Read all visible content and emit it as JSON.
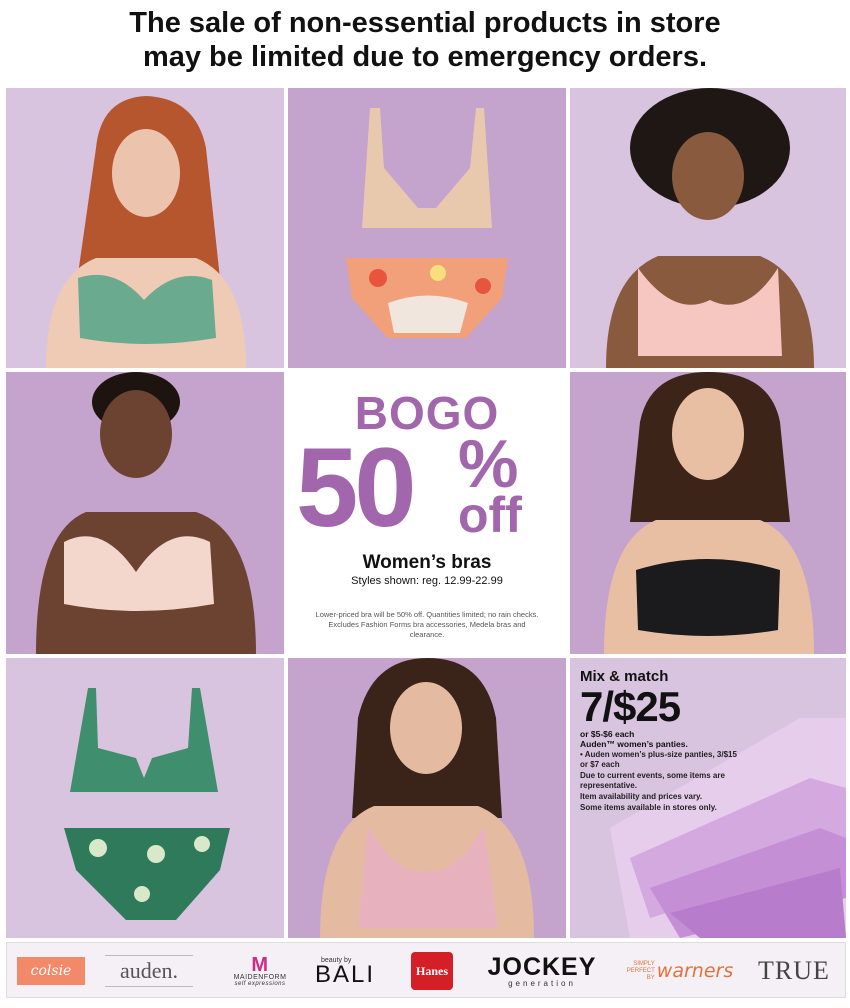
{
  "header": {
    "line1": "The sale of non-essential products in store",
    "line2": "may be limited due to emergency orders."
  },
  "tiles": {
    "r1c1": {
      "icon": "model-green-bra-photo"
    },
    "r1c2": {
      "icon": "nude-bralette-floral-panty-photo"
    },
    "r1c3": {
      "icon": "model-pink-bralette-photo"
    },
    "r2c1": {
      "icon": "model-blush-lace-bra-photo"
    },
    "r2c3": {
      "icon": "model-black-strapless-bra-photo"
    },
    "r3c1": {
      "icon": "green-bra-floral-panty-photo"
    },
    "r3c2": {
      "icon": "model-pink-lace-bralette-photo"
    },
    "r3c3": {
      "icon": "lilac-panties-stack-photo"
    }
  },
  "promo": {
    "bogo": "BOGO",
    "fifty": "50",
    "percent": "%",
    "off": "off",
    "title": "Women’s bras",
    "subtitle": "Styles shown: reg. 12.99-22.99",
    "fine_print": "Lower-priced bra will be 50% off. Quantities limited; no rain checks. Excludes Fashion Forms bra accessories, Medela bras and clearance."
  },
  "mix_match": {
    "title": "Mix & match",
    "price": "7/$25",
    "line1": "or $5-$6 each",
    "line2": "Auden™ women’s panties.",
    "fine1": "• Auden women’s plus-size panties, 3/$15 or $7 each",
    "fine2": "Due to current events, some items are representative.",
    "fine3": "Item availability and prices vary.",
    "fine4": "Some items available in stores only."
  },
  "brands": {
    "colsie": "colsie",
    "auden": "auden.",
    "maidenform_mark": "M",
    "maidenform": "MAIDENFORM",
    "maidenform_tag": "self expressions",
    "bali_small": "beauty by",
    "bali": "BALI",
    "hanes": "Hanes",
    "jockey": "JOCKEY",
    "jockey_sub": "generation",
    "warners_small": "SIMPLY PERFECT BY",
    "warners": "warners",
    "true": "TRUE"
  },
  "colors": {
    "accent": "#a266ad",
    "tile_light": "#d9c4df",
    "tile_mid": "#c4a3cc"
  }
}
